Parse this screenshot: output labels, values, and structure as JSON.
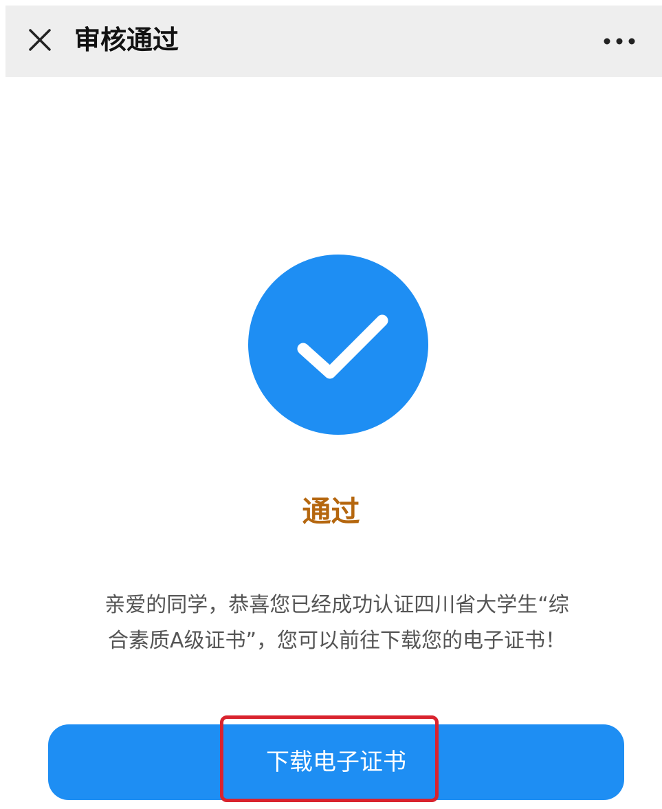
{
  "nav": {
    "title": "审核通过",
    "close_icon": "close-icon",
    "more_icon": "more-horizontal-icon"
  },
  "result": {
    "icon": "check-circle-icon",
    "icon_color": "#1e8ef3",
    "status": "通过",
    "status_color": "#b5670f"
  },
  "message": {
    "line1": "亲爱的同学，恭喜您已经成功认证四川省大学生“综",
    "line2": "合素质A级证书”，您可以前往下载您的电子证书！"
  },
  "action": {
    "download_label": "下载电子证书",
    "button_color": "#1e8ef3",
    "highlight_color": "#d9232e"
  }
}
